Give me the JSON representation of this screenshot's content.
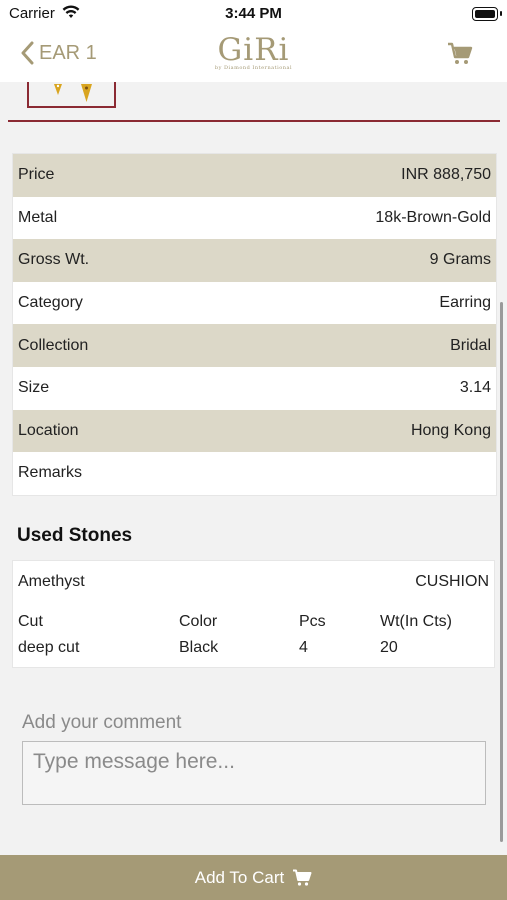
{
  "status_bar": {
    "carrier": "Carrier",
    "time": "3:44 PM"
  },
  "nav": {
    "back_label": "EAR 1",
    "logo": "GiRi",
    "logo_sub": "by Diamond International"
  },
  "details": [
    {
      "label": "Price",
      "value": "INR 888,750"
    },
    {
      "label": "Metal",
      "value": "18k-Brown-Gold"
    },
    {
      "label": "Gross Wt.",
      "value": "9 Grams"
    },
    {
      "label": "Category",
      "value": "Earring"
    },
    {
      "label": "Collection",
      "value": "Bridal"
    },
    {
      "label": "Size",
      "value": "3.14"
    },
    {
      "label": "Location",
      "value": "Hong Kong"
    },
    {
      "label": "Remarks",
      "value": ""
    }
  ],
  "used_stones": {
    "title": "Used Stones",
    "stone": {
      "name": "Amethyst",
      "shape": "CUSHION"
    },
    "headers": {
      "cut": "Cut",
      "color": "Color",
      "pcs": "Pcs",
      "wt": "Wt(In Cts)"
    },
    "values": {
      "cut": "deep cut",
      "color": "Black",
      "pcs": "4",
      "wt": "20"
    }
  },
  "comment": {
    "label": "Add your comment",
    "placeholder": "Type message here..."
  },
  "cart_button": {
    "label": "Add To Cart"
  },
  "colors": {
    "accent": "#a59a76",
    "divider": "#8b2a33",
    "row_alt": "#dcd8c8"
  },
  "icons": [
    "wifi-icon",
    "battery-icon",
    "chevron-left-icon",
    "cart-icon"
  ]
}
